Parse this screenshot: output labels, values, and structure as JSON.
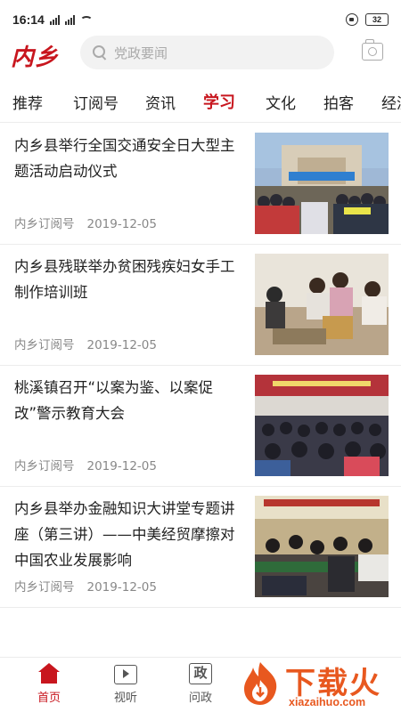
{
  "status_bar": {
    "time": "16:14",
    "network_label": "4G",
    "battery": "32"
  },
  "header": {
    "logo_text": "内乡",
    "search_placeholder": "党政要闻"
  },
  "tabs": [
    {
      "label": "推荐",
      "active": false
    },
    {
      "label": "订阅号",
      "active": false
    },
    {
      "label": "资讯",
      "active": false
    },
    {
      "label": "学习",
      "active": true
    },
    {
      "label": "文化",
      "active": false
    },
    {
      "label": "拍客",
      "active": false
    },
    {
      "label": "经济",
      "active": false
    }
  ],
  "news": [
    {
      "title": "内乡县举行全国交通安全日大型主题活动启动仪式",
      "source": "内乡订阅号",
      "date": "2019-12-05",
      "thumb_icon": "traffic-safety-event-photo"
    },
    {
      "title": "内乡县残联举办贫困残疾妇女手工制作培训班",
      "source": "内乡订阅号",
      "date": "2019-12-05",
      "thumb_icon": "handcraft-training-photo"
    },
    {
      "title": "桃溪镇召开“以案为鉴、以案促改”警示教育大会",
      "source": "内乡订阅号",
      "date": "2019-12-05",
      "thumb_icon": "warning-education-meeting-photo"
    },
    {
      "title": "内乡县举办金融知识大讲堂专题讲座（第三讲）——中美经贸摩擦对中国农业发展影响",
      "source": "内乡订阅号",
      "date": "2019-12-05",
      "thumb_icon": "finance-lecture-photo"
    }
  ],
  "bottom_nav": [
    {
      "label": "首页",
      "icon": "home-icon",
      "active": true
    },
    {
      "label": "视听",
      "icon": "tv-icon",
      "active": false
    },
    {
      "label": "问政",
      "icon": "zheng-icon",
      "active": false
    }
  ],
  "bottom_nav_zheng_glyph": "政",
  "watermark": {
    "text": "下载火",
    "url": "xiazaihuo.com"
  },
  "colors": {
    "accent": "#c8161e",
    "watermark": "#e8581f"
  }
}
